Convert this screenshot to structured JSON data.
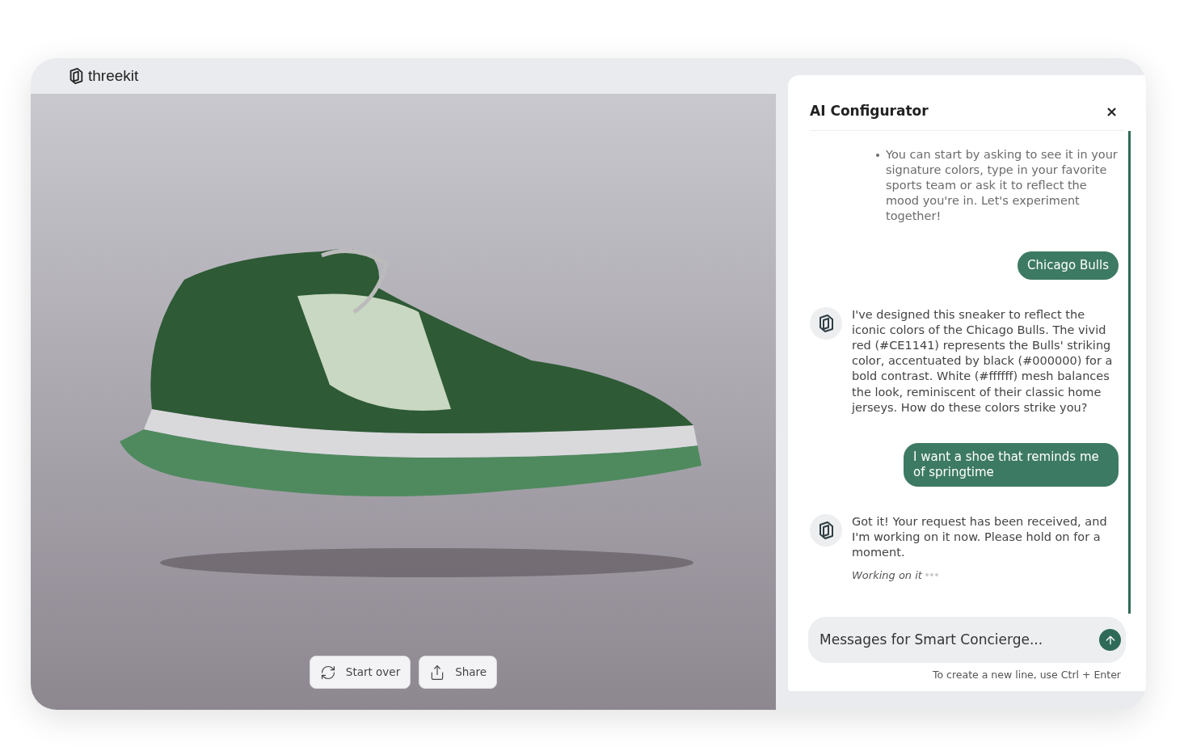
{
  "brand": {
    "name": "threekit"
  },
  "viewer": {
    "buttons": [
      {
        "kind": "restart",
        "label": "Start over"
      },
      {
        "kind": "share",
        "label": "Share"
      }
    ]
  },
  "panel": {
    "title": "AI Configurator",
    "close": "×",
    "messages": [
      {
        "kind": "tip",
        "text": "You can start by asking to see it in your signature colors, type in your favorite sports team or ask it to reflect the mood you're in. Let's experiment together!"
      },
      {
        "kind": "user",
        "text": "Chicago Bulls"
      },
      {
        "kind": "assistant",
        "text": "I've designed this sneaker to reflect the iconic colors of the Chicago Bulls. The vivid red (#CE1141) represents the Bulls' striking color, accentuated by black (#000000) for a bold contrast. White (#ffffff) mesh balances the look, reminiscent of their classic home jerseys. How do these colors strike you?"
      },
      {
        "kind": "user",
        "text": "I want a shoe that reminds me of springtime"
      },
      {
        "kind": "assistant",
        "text": "Got it! Your request has been received, and I'm working on it now. Please hold on for a moment.",
        "status": "Working on it"
      }
    ],
    "input": {
      "placeholder": "Messages for Smart Concierge..."
    },
    "hint": "To create a new line, use Ctrl + Enter"
  }
}
